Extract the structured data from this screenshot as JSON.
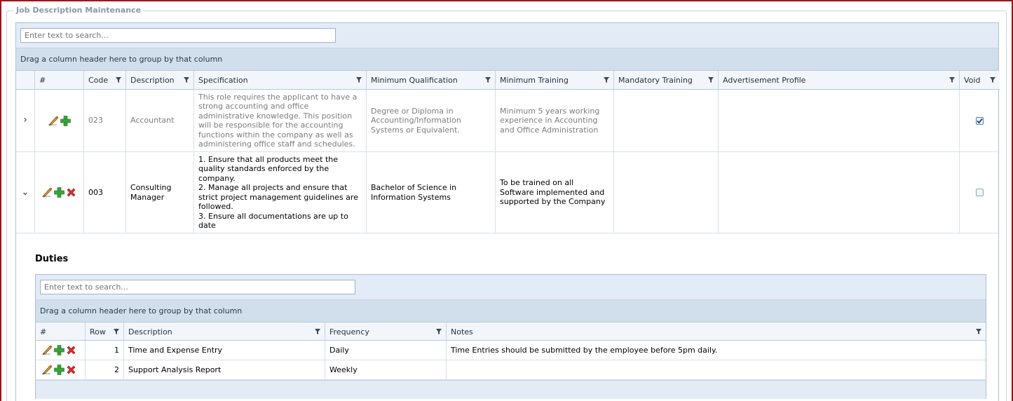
{
  "panel": {
    "title": "Job Description Maintenance"
  },
  "colors": {
    "border_accent": "#a0141c",
    "header_bg": "#d1dfec",
    "toolbar_bg": "#e3ecf6"
  },
  "grid": {
    "search_placeholder": "Enter text to search...",
    "group_hint": "Drag a column header here to group by that column",
    "columns": [
      "#",
      "Code",
      "Description",
      "Specification",
      "Minimum Qualification",
      "Minimum Training",
      "Mandatory Training",
      "Advertisement Profile",
      "Void"
    ],
    "rows": [
      {
        "expander": "›",
        "code": "023",
        "description": "Accountant",
        "specification": "This role requires the applicant to have a strong accounting and office administrative knowledge. This position will be responsible for the accounting functions within the company as well as administering office staff and schedules.",
        "min_qualification": "Degree or Diploma in Accounting/Information Systems or Equivalent.",
        "min_training": "Minimum 5 years working experience in Accounting and Office Administration",
        "mandatory_training": "",
        "ad_profile": "",
        "void": true
      },
      {
        "expander": "⌄",
        "code": "003",
        "description": "Consulting Manager",
        "specification": "1. Ensure that all products meet the quality standards enforced by the company.\n2. Manage all projects and ensure that strict project management guidelines are followed.\n3. Ensure all documentations are up to date",
        "min_qualification": "Bachelor of Science in Information Systems",
        "min_training": "To be trained on all Software implemented and supported by the Company",
        "mandatory_training": "",
        "ad_profile": "",
        "void": false
      }
    ]
  },
  "duties": {
    "title": "Duties",
    "search_placeholder": "Enter text to search...",
    "group_hint": "Drag a column header here to group by that column",
    "columns": [
      "#",
      "Row",
      "Description",
      "Frequency",
      "Notes"
    ],
    "rows": [
      {
        "row": "1",
        "description": "Time and Expense Entry",
        "frequency": "Daily",
        "notes": "Time Entries should be submitted by the employee before 5pm daily."
      },
      {
        "row": "2",
        "description": "Support Analysis Report",
        "frequency": "Weekly",
        "notes": ""
      }
    ]
  }
}
